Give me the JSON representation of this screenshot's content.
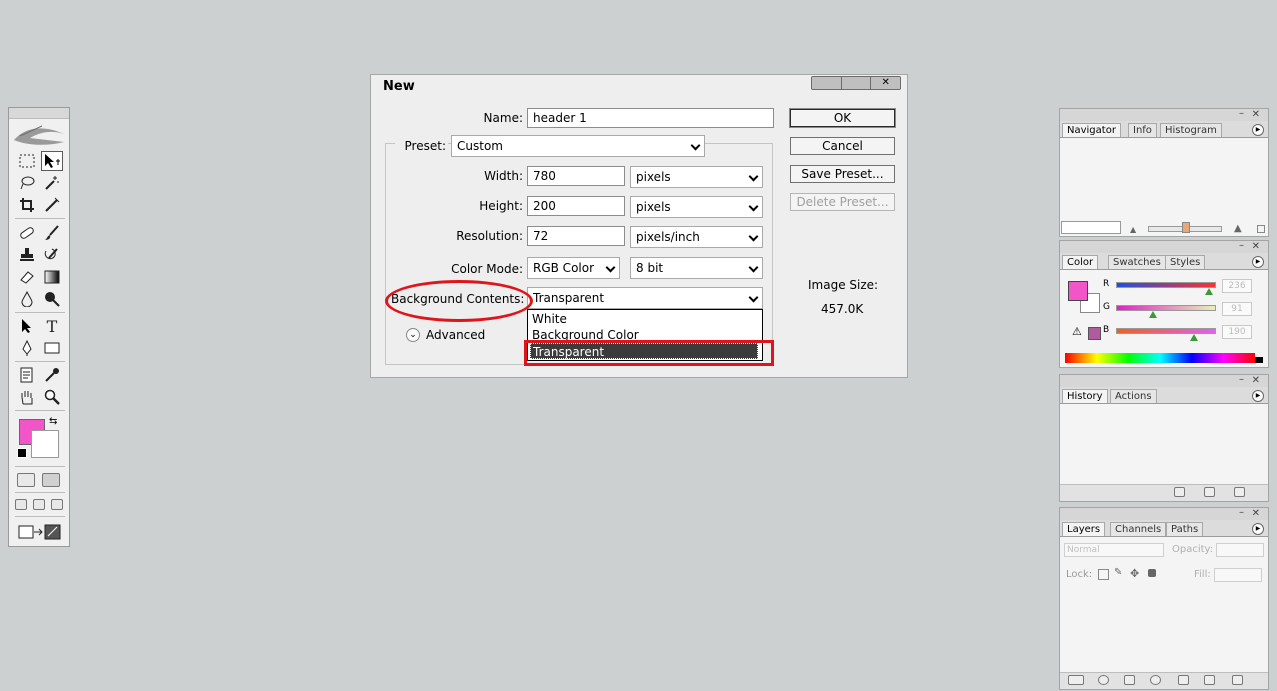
{
  "dialog": {
    "title": "New",
    "name_label": "Name:",
    "name_value": "header 1",
    "preset_label": "Preset:",
    "preset_value": "Custom",
    "width_label": "Width:",
    "width_value": "780",
    "width_unit": "pixels",
    "height_label": "Height:",
    "height_value": "200",
    "height_unit": "pixels",
    "resolution_label": "Resolution:",
    "resolution_value": "72",
    "resolution_unit": "pixels/inch",
    "color_mode_label": "Color Mode:",
    "color_mode_value": "RGB Color",
    "bit_depth_value": "8 bit",
    "background_label": "Background Contents:",
    "background_value": "Transparent",
    "background_options": [
      "White",
      "Background Color",
      "Transparent"
    ],
    "advanced_label": "Advanced",
    "ok_label": "OK",
    "cancel_label": "Cancel",
    "save_preset_label": "Save Preset...",
    "delete_preset_label": "Delete Preset...",
    "image_size_label": "Image Size:",
    "image_size_value": "457.0K"
  },
  "panels": {
    "navigator": {
      "tabs": [
        "Navigator",
        "Info",
        "Histogram"
      ]
    },
    "color": {
      "tabs": [
        "Color",
        "Swatches",
        "Styles"
      ],
      "channels": [
        "R",
        "G",
        "B"
      ],
      "values": [
        "236",
        "91",
        "190"
      ]
    },
    "history": {
      "tabs": [
        "History",
        "Actions"
      ]
    },
    "layers": {
      "tabs": [
        "Layers",
        "Channels",
        "Paths"
      ],
      "blend_mode": "Normal",
      "opacity_label": "Opacity:",
      "lock_label": "Lock:",
      "fill_label": "Fill:"
    }
  },
  "colors": {
    "foreground": "#f155c8",
    "background": "#ffffff",
    "annotation_red": "#e0151c"
  }
}
